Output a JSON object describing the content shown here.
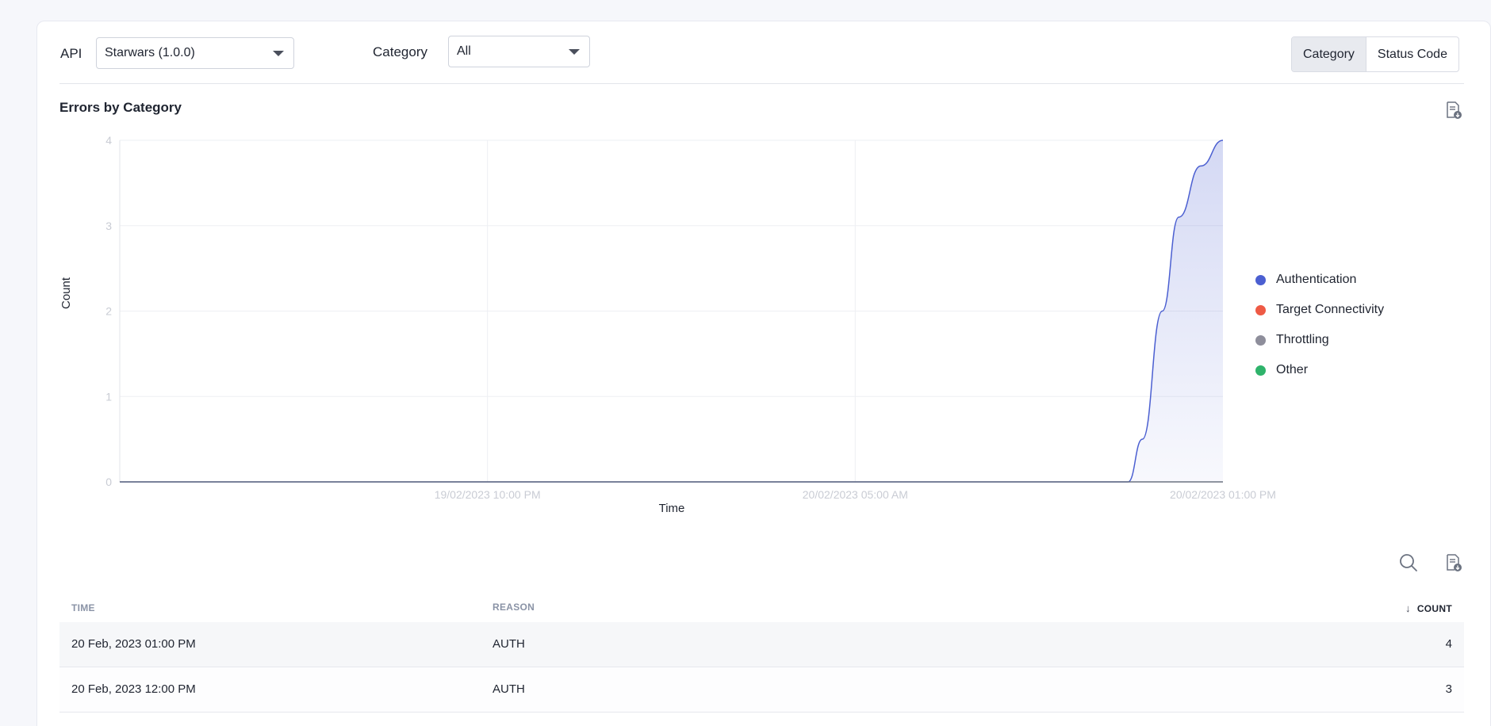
{
  "filters": {
    "api_label": "API",
    "api_value": "Starwars (1.0.0)",
    "category_label": "Category",
    "category_value": "All"
  },
  "view_toggle": {
    "options": [
      "Category",
      "Status Code"
    ],
    "active": "Category"
  },
  "chart": {
    "title": "Errors by Category",
    "icons": {
      "download": "download-report-icon"
    }
  },
  "chart_data": {
    "type": "area",
    "title": "Errors by Category",
    "xlabel": "Time",
    "ylabel": "Count",
    "ylim": [
      0,
      4
    ],
    "y_ticks": [
      "0",
      "1",
      "2",
      "3",
      "4"
    ],
    "x_ticks": [
      "19/02/2023 10:00 PM",
      "20/02/2023 05:00 AM",
      "20/02/2023 01:00 PM"
    ],
    "grid": true,
    "legend_position": "right",
    "series": [
      {
        "name": "Authentication",
        "color": "#4b5fd1",
        "points": [
          [
            0,
            0
          ],
          [
            0.914,
            0
          ],
          [
            0.927,
            0.5
          ],
          [
            0.945,
            2.0
          ],
          [
            0.96,
            3.1
          ],
          [
            0.98,
            3.7
          ],
          [
            1.0,
            4
          ]
        ]
      },
      {
        "name": "Target Connectivity",
        "color": "#ee5a45",
        "points": []
      },
      {
        "name": "Throttling",
        "color": "#8e8e9b",
        "points": []
      },
      {
        "name": "Other",
        "color": "#2fb36b",
        "points": []
      }
    ]
  },
  "table": {
    "icons": {
      "search": "search-icon",
      "download": "download-report-icon"
    },
    "columns": {
      "time": "TIME",
      "reason": "REASON",
      "count": "COUNT"
    },
    "rows": [
      {
        "time": "20 Feb, 2023 01:00 PM",
        "reason": "AUTH",
        "count": "4"
      },
      {
        "time": "20 Feb, 2023 12:00 PM",
        "reason": "AUTH",
        "count": "3"
      }
    ]
  }
}
